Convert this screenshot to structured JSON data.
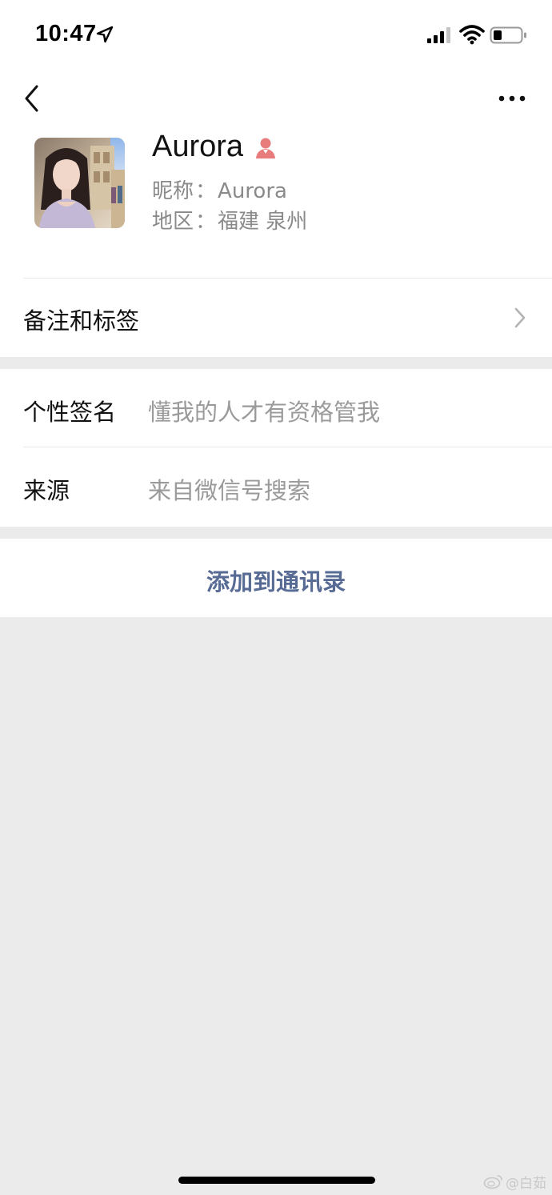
{
  "status_bar": {
    "time": "10:47",
    "icons": [
      "location-arrow-icon",
      "signal-icon",
      "wifi-icon",
      "battery-icon"
    ]
  },
  "nav": {
    "back_icon": "chevron-left-icon",
    "more_icon": "ellipsis-icon"
  },
  "profile": {
    "name": "Aurora",
    "gender_icon": "female-icon",
    "nickname_label": "昵称",
    "nickname_value": "Aurora",
    "region_label": "地区",
    "region_value": "福建 泉州"
  },
  "remark": {
    "label": "备注和标签"
  },
  "details": {
    "signature_label": "个性签名",
    "signature_value": "懂我的人才有资格管我",
    "source_label": "来源",
    "source_value": "来自微信号搜索"
  },
  "actions": {
    "add_to_contacts": "添加到通讯录"
  },
  "watermark": {
    "text": "@白茹"
  },
  "colors": {
    "background": "#ebebeb",
    "link_blue": "#576b95",
    "female_icon": "#e87c7c",
    "secondary_text": "#8a8a8a"
  }
}
